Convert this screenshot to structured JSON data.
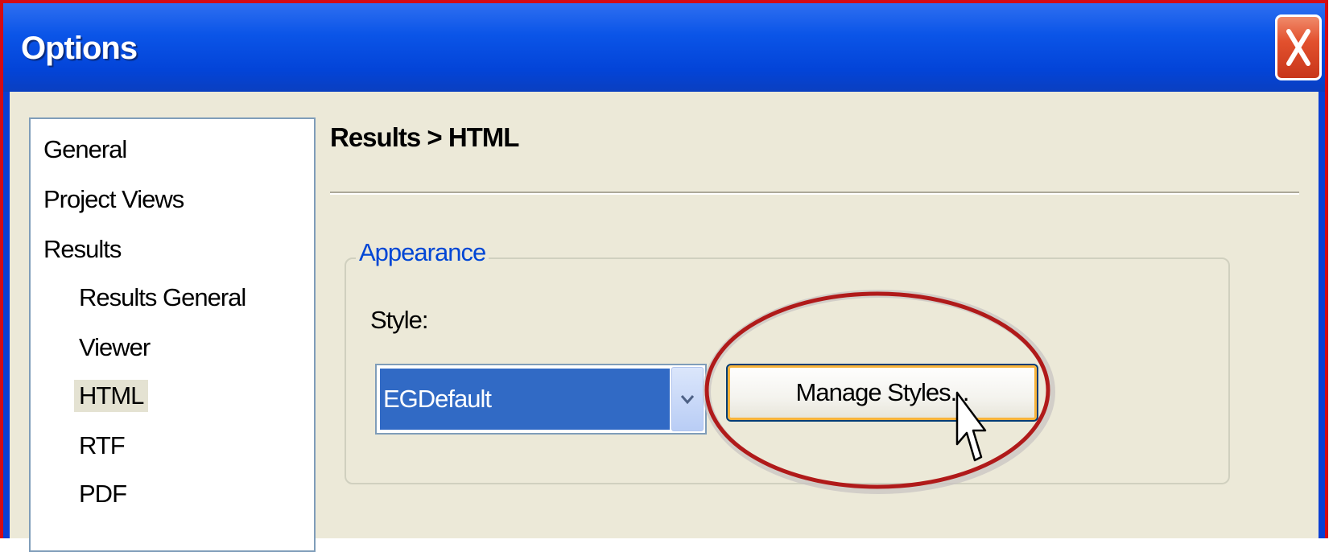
{
  "window": {
    "title": "Options",
    "close_icon": "close-x-icon",
    "colors": {
      "titlebar": "#0b55e8",
      "close_button": "#e2512e",
      "frame_outline": "#d40b14",
      "client_background": "#ece9d8",
      "highlight_ellipse": "#b01a1a"
    }
  },
  "nav": {
    "items": [
      {
        "label": "General",
        "level": 0,
        "selected": false
      },
      {
        "label": "Project Views",
        "level": 0,
        "selected": false
      },
      {
        "label": "Results",
        "level": 0,
        "selected": false
      },
      {
        "label": "Results General",
        "level": 1,
        "selected": false
      },
      {
        "label": "Viewer",
        "level": 1,
        "selected": false
      },
      {
        "label": "HTML",
        "level": 1,
        "selected": true
      },
      {
        "label": "RTF",
        "level": 1,
        "selected": false
      },
      {
        "label": "PDF",
        "level": 1,
        "selected": false
      }
    ]
  },
  "page": {
    "breadcrumb": "Results > HTML"
  },
  "appearance": {
    "legend": "Appearance",
    "style_label": "Style:",
    "style_value": "EGDefault",
    "dropdown_icon": "chevron-down-icon",
    "manage_button": "Manage Styles..."
  }
}
